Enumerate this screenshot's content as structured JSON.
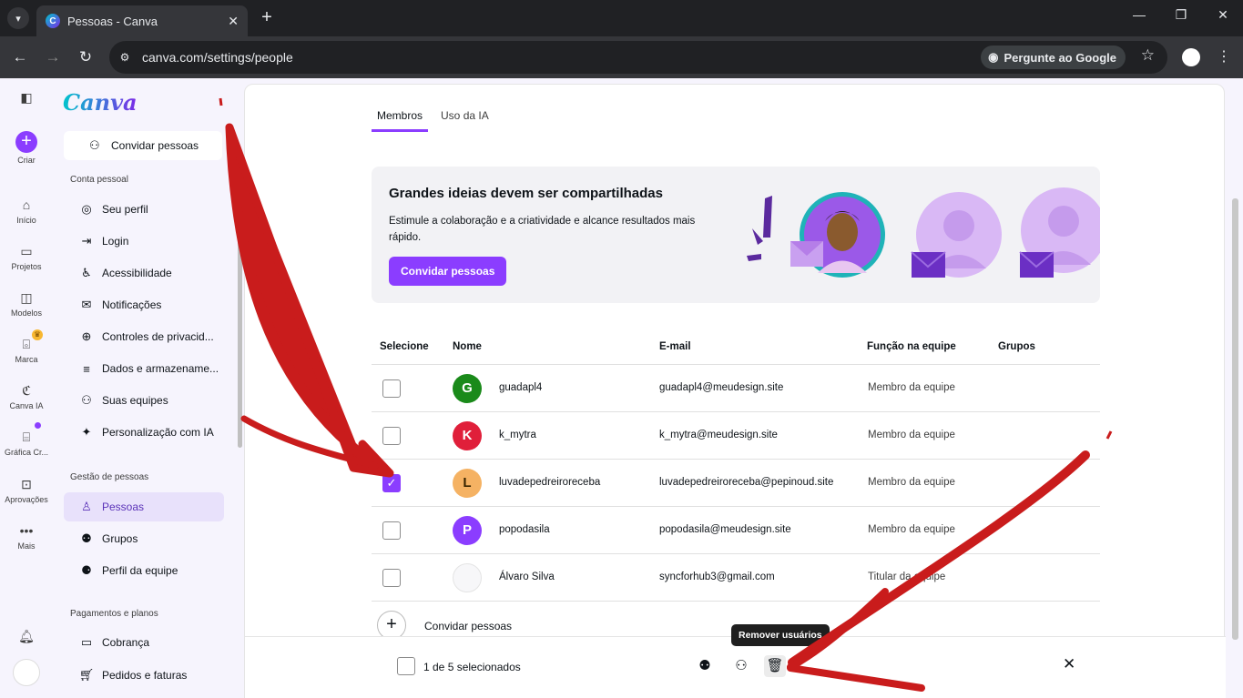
{
  "browser": {
    "tab_title": "Pessoas - Canva",
    "tab_close": "✕",
    "favicon_letter": "C",
    "url": "canva.com/settings/people",
    "ask_google": "Pergunte ao Google"
  },
  "rail": {
    "create": "Criar",
    "home": "Início",
    "projects": "Projetos",
    "templates": "Modelos",
    "brand": "Marca",
    "ai": "Canva IA",
    "print": "Gráfica Cr...",
    "approvals": "Aprovações",
    "more": "Mais"
  },
  "sidebar": {
    "logo": "Canva",
    "invite": "Convidar pessoas",
    "section_personal": "Conta pessoal",
    "section_people": "Gestão de pessoas",
    "section_billing": "Pagamentos e planos",
    "items": [
      {
        "label": "Seu perfil"
      },
      {
        "label": "Login"
      },
      {
        "label": "Acessibilidade"
      },
      {
        "label": "Notificações"
      },
      {
        "label": "Controles de privacid..."
      },
      {
        "label": "Dados e armazename..."
      },
      {
        "label": "Suas equipes"
      },
      {
        "label": "Personalização com IA"
      },
      {
        "label": "Pessoas"
      },
      {
        "label": "Grupos"
      },
      {
        "label": "Perfil da equipe"
      },
      {
        "label": "Cobrança"
      },
      {
        "label": "Pedidos e faturas"
      }
    ]
  },
  "main": {
    "tabs": [
      {
        "label": "Membros"
      },
      {
        "label": "Uso da IA"
      }
    ],
    "banner": {
      "title": "Grandes ideias devem ser compartilhadas",
      "text": "Estimule a colaboração e a criatividade e alcance resultados mais rápido.",
      "button": "Convidar pessoas"
    },
    "table": {
      "headers": [
        "Selecione",
        "Nome",
        "E-mail",
        "Função na equipe",
        "Grupos"
      ],
      "rows": [
        {
          "initial": "G",
          "color": "#1a8a1a",
          "name": "guadapl4",
          "email": "guadapl4@meudesign.site",
          "role": "Membro da equipe",
          "checked": false
        },
        {
          "initial": "K",
          "color": "#e01f3a",
          "name": "k_mytra",
          "email": "k_mytra@meudesign.site",
          "role": "Membro da equipe",
          "checked": false
        },
        {
          "initial": "L",
          "color": "#f5b263",
          "name": "luvadepedreiroreceba",
          "email": "luvadepedreiroreceba@pepinoud.site",
          "role": "Membro da equipe",
          "checked": true
        },
        {
          "initial": "P",
          "color": "#8b3dff",
          "name": "popodasila",
          "email": "popodasila@meudesign.site",
          "role": "Membro da equipe",
          "checked": false
        },
        {
          "initial": "",
          "color": "#f7f7f9",
          "name": "Álvaro Silva",
          "email": "syncforhub3@gmail.com",
          "role": "Titular da equipe",
          "checked": false
        }
      ]
    },
    "invite_row": "Convidar pessoas",
    "actionbar": {
      "count": "1 de 5 selecionados",
      "tooltip": "Remover usuários"
    }
  }
}
